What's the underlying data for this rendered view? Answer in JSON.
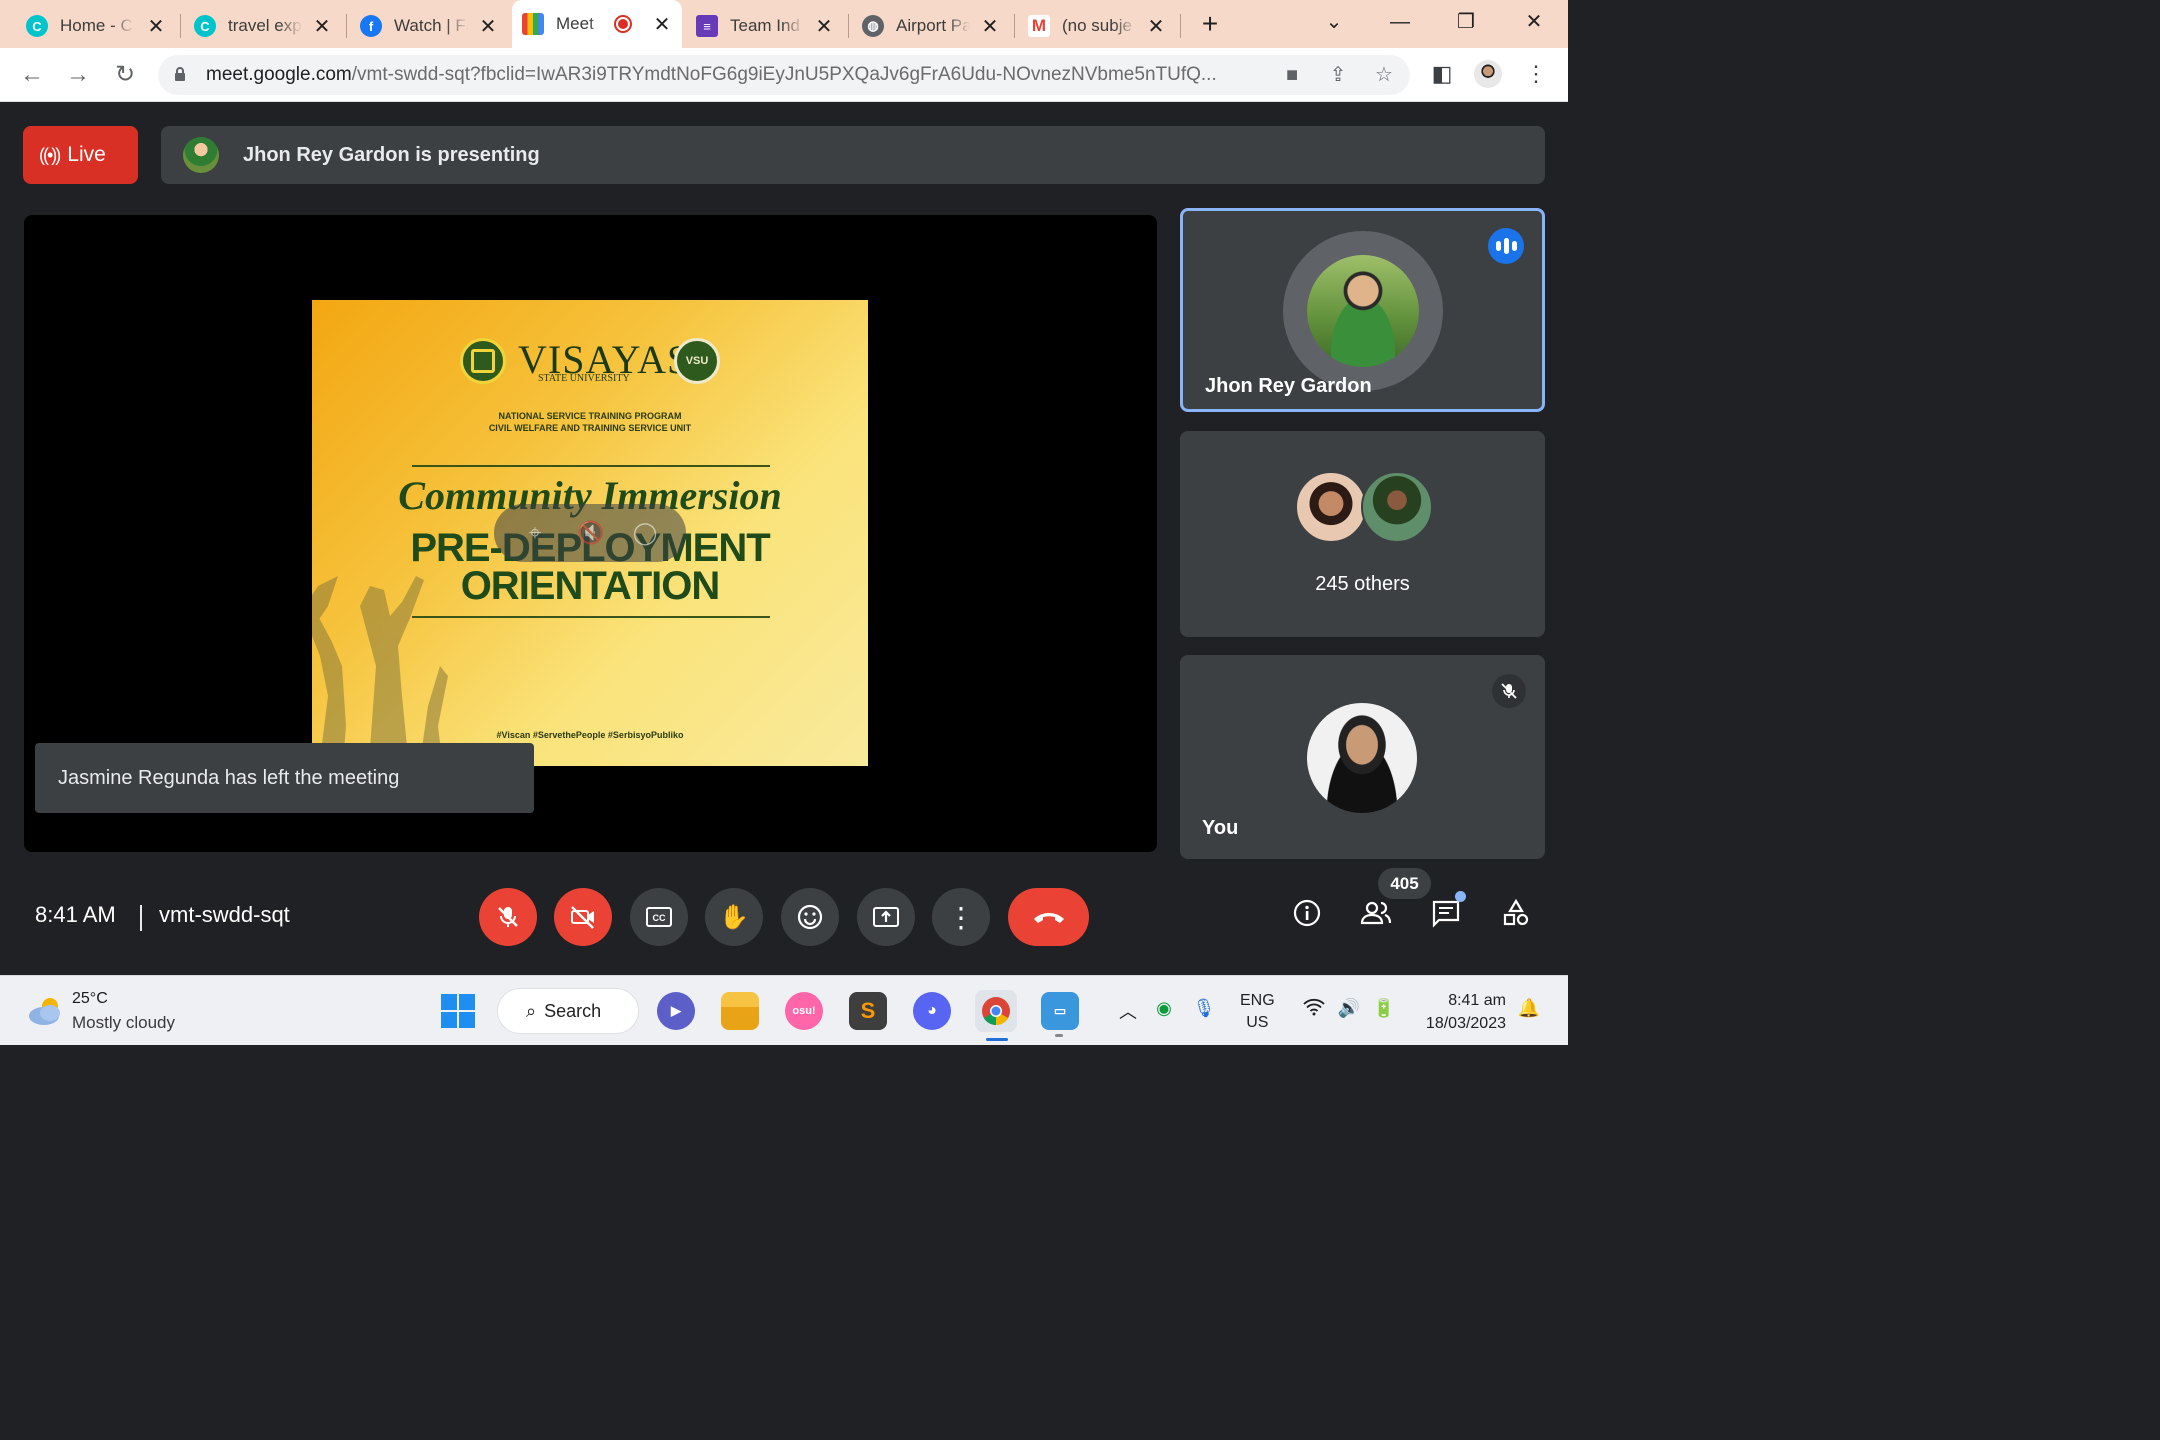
{
  "browser": {
    "tabs": [
      {
        "title": "Home - C",
        "icon": "canva-icon",
        "color": "#00c4cc"
      },
      {
        "title": "travel exp",
        "icon": "canva-icon",
        "color": "#00c4cc"
      },
      {
        "title": "Watch | Fa",
        "icon": "facebook-icon",
        "color": "#1877f2"
      },
      {
        "title": "Meet",
        "icon": "meet-icon",
        "color": "#00897b"
      },
      {
        "title": "Team Ind",
        "icon": "forms-icon",
        "color": "#673ab7"
      },
      {
        "title": "Airport Pa",
        "icon": "globe-icon",
        "color": "#5f6368"
      },
      {
        "title": "(no subje",
        "icon": "gmail-icon",
        "color": "#ea4335"
      }
    ],
    "url_host": "meet.google.com",
    "url_path": "/vmt-swdd-sqt?fbclid=IwAR3i9TRYmdtNoFG6g9iEyJnU5PXQaJv6gFrA6Udu-NOvnezNVbme5nTUfQ..."
  },
  "meet": {
    "live_label": "Live",
    "presenting_text": "Jhon Rey Gardon is presenting",
    "toast": "Jasmine Regunda has left the meeting",
    "tiles": {
      "speaker_name": "Jhon Rey Gardon",
      "others_label": "245 others",
      "self_label": "You"
    },
    "time": "8:41 AM",
    "meeting_code": "vmt-swdd-sqt",
    "participant_count": "405",
    "colors": {
      "accent": "#8ab4f8",
      "danger": "#ea4335",
      "speaking": "#1a73e8"
    }
  },
  "slide": {
    "university": "VISAYAS",
    "university_sub": "STATE UNIVERSITY",
    "program_line1": "NATIONAL SERVICE TRAINING PROGRAM",
    "program_line2": "CIVIL WELFARE AND TRAINING SERVICE UNIT",
    "script_title": "Community Immersion",
    "title_line1": "PRE-DEPLOYMENT",
    "title_line2": "ORIENTATION",
    "hashtags": "#Viscan  #ServethePeople  #SerbisyoPubliko",
    "seal_text": "VSU"
  },
  "taskbar": {
    "temperature": "25°C",
    "weather": "Mostly cloudy",
    "search_label": "Search",
    "lang_top": "ENG",
    "lang_bottom": "US",
    "clock_time": "8:41 am",
    "clock_date": "18/03/2023",
    "osu_label": "osu!"
  }
}
